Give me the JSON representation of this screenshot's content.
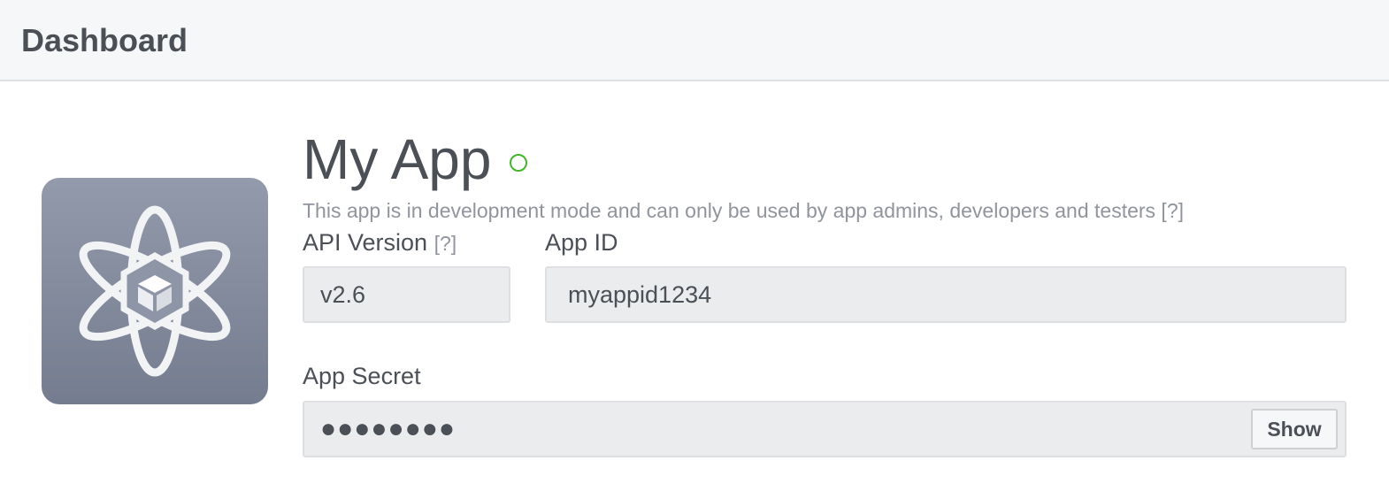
{
  "header": {
    "title": "Dashboard"
  },
  "app": {
    "icon": "atom-cube-icon",
    "name": "My App",
    "status_icon": "status-circle-icon",
    "status_color": "#42b72a",
    "dev_note": "This app is in development mode and can only be used by app admins, developers and testers [?]"
  },
  "fields": {
    "api_version": {
      "label": "API Version",
      "help": "[?]",
      "value": "v2.6"
    },
    "app_id": {
      "label": "App ID",
      "value": "myappid1234"
    },
    "app_secret": {
      "label": "App Secret",
      "value": "●●●●●●●●",
      "show_label": "Show"
    }
  }
}
